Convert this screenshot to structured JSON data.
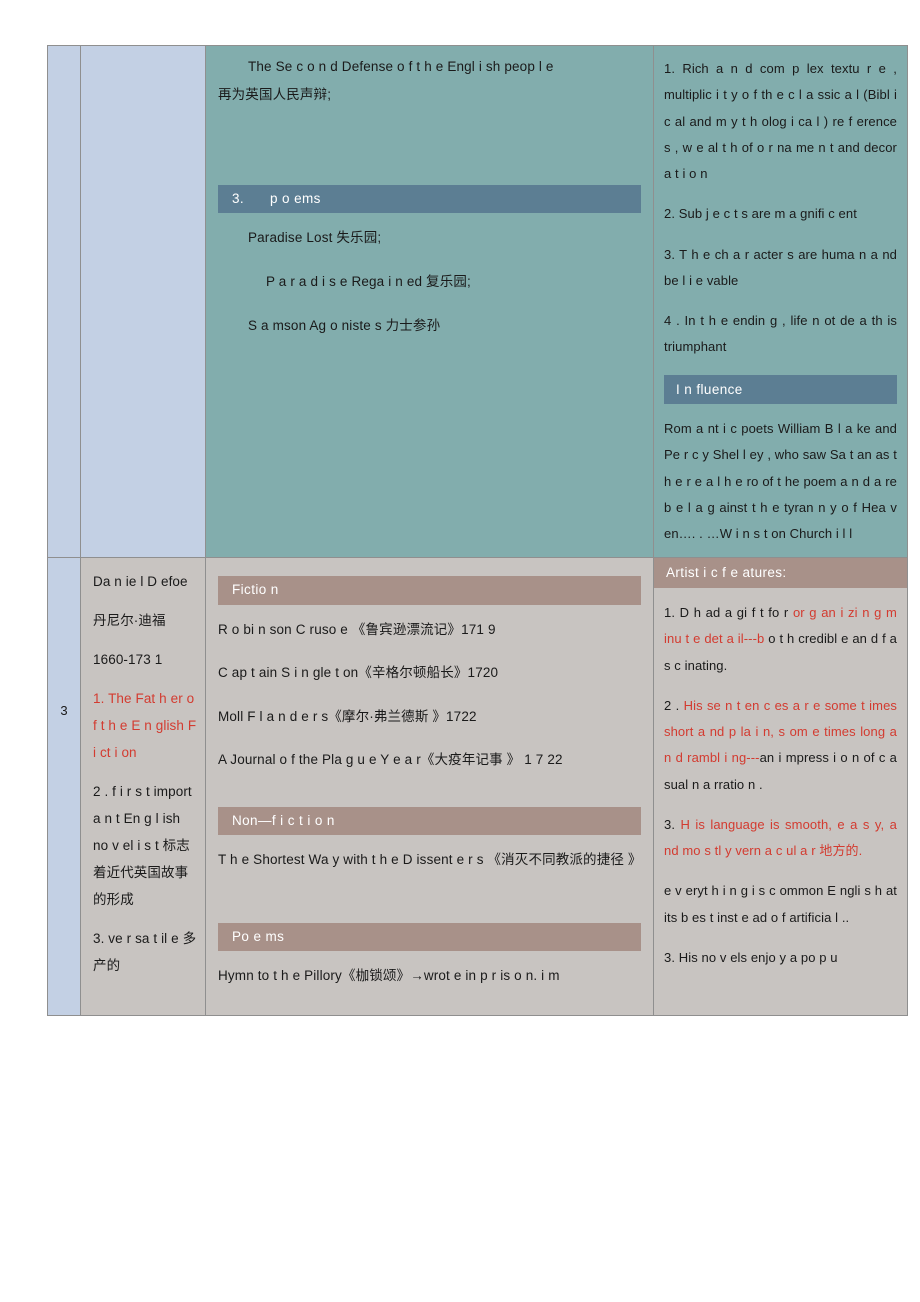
{
  "table": {
    "row1": {
      "number": "",
      "name": "",
      "works": {
        "intro_line": "The Se c o n d Defense    o f    t h e Engl i sh   peop l e",
        "intro_line_cn": "再为英国人民声辩;",
        "section_poems": {
          "num": "3.",
          "label": "p o ems"
        },
        "poems": [
          "Paradise   Lost 失乐园;",
          "P a r a d i s e   Rega  i  n ed 复乐园;",
          "S a mson Ag o niste s 力士参孙"
        ]
      },
      "features": [
        "1. Rich    a n d com p lex textu r e , multiplic i t y  o f  th e    c l a ssic a l  (Bibl i c al   and m y t h olog i ca l ) re f erence s ,   w e al t h   of   o r na me n t and decor a t i o n",
        "2.   Sub j e c t s are   m a gnifi c ent",
        "3.   T h e   ch a r acter s  are huma n   a nd be l  i  e vable",
        "4 . In  t h e  endin g ,  life   n ot de a th is triumphant"
      ],
      "influence": {
        "heading": "I  n fluence",
        "body": "Rom a nt i  c  poets William  B l a ke and Pe r  c y Shel l ey ,   who saw Sa t an as  t h e r e a l  h e ro of  t he   poem a n d   a  re b e l  a  g ainst t  h e tyran n  y    o f  Hea  v en…. .  …W  i  n  s  t  on Church i l l"
      }
    },
    "row2": {
      "number": "3",
      "name": {
        "author_en": "Da  n ie  l   D efoe",
        "author_cn": "丹尼尔·迪福",
        "years": "1660-173 1",
        "point1": "1. The Fat h er  o f   t h e E n glish F i ct i on",
        "point2": "2 .   f i r s t import a n t En g  l ish no v el  i  s  t 标志着近代英国故事的形成",
        "point3": "3.   ve r sa t il e   多产的"
      },
      "works": {
        "section_fiction": "Fictio n",
        "fiction": [
          "R o bi n son  C ruso e 《鲁宾逊漂流记》171 9",
          "C ap t ain S i  n gle t on《辛格尔顿船长》1720",
          "Moll  F  l  a n d e r s《摩尔·弗兰德斯 》1722",
          "A Journal o f  the Pla g  u e  Y e a r《大疫年记事 》 1 7 22"
        ],
        "section_nonfiction": "Non—f i c t i o n",
        "nonfiction": [
          "T h e Shortest Wa y  with t h e  D issent e r s 《消灭不同教派的捷径 》"
        ],
        "section_poems": "Po e ms",
        "poems": [
          "Hymn to t h  e    Pillory《枷锁颂》→wrot e  in p r is o n.  i m"
        ]
      },
      "features": {
        "heading": "Artist i  c f e atures:",
        "p1_black_a": "1. D  h ad   a gi f t fo r  ",
        "p1_red_a": "or g an i zi n g  m inu t e det a il---b",
        "p1_black_b": " o t h credibl e  an d  f a s c inating.",
        "p2_black_a": "2 .   ",
        "p2_red_a": "His se n  t en c es a r e some t imes  short   a nd  p la i n, s om e times long   a n d  rambl i ng---",
        "p2_black_b": "an   i mpress i o n   of c a sual n a rratio n .",
        "p3_black_a": "3.   ",
        "p3_red_a": "H is   language is smooth, e a s y,  a nd  mo s tl y  vern a c ul a r 地方的.",
        "p4": "e v eryt h i n g i s   c ommon  E ngli s h at its  b es t    inst e ad  o f artificia l ..",
        "p5": "3. His   no v els   enjo y  a po p u"
      }
    }
  }
}
